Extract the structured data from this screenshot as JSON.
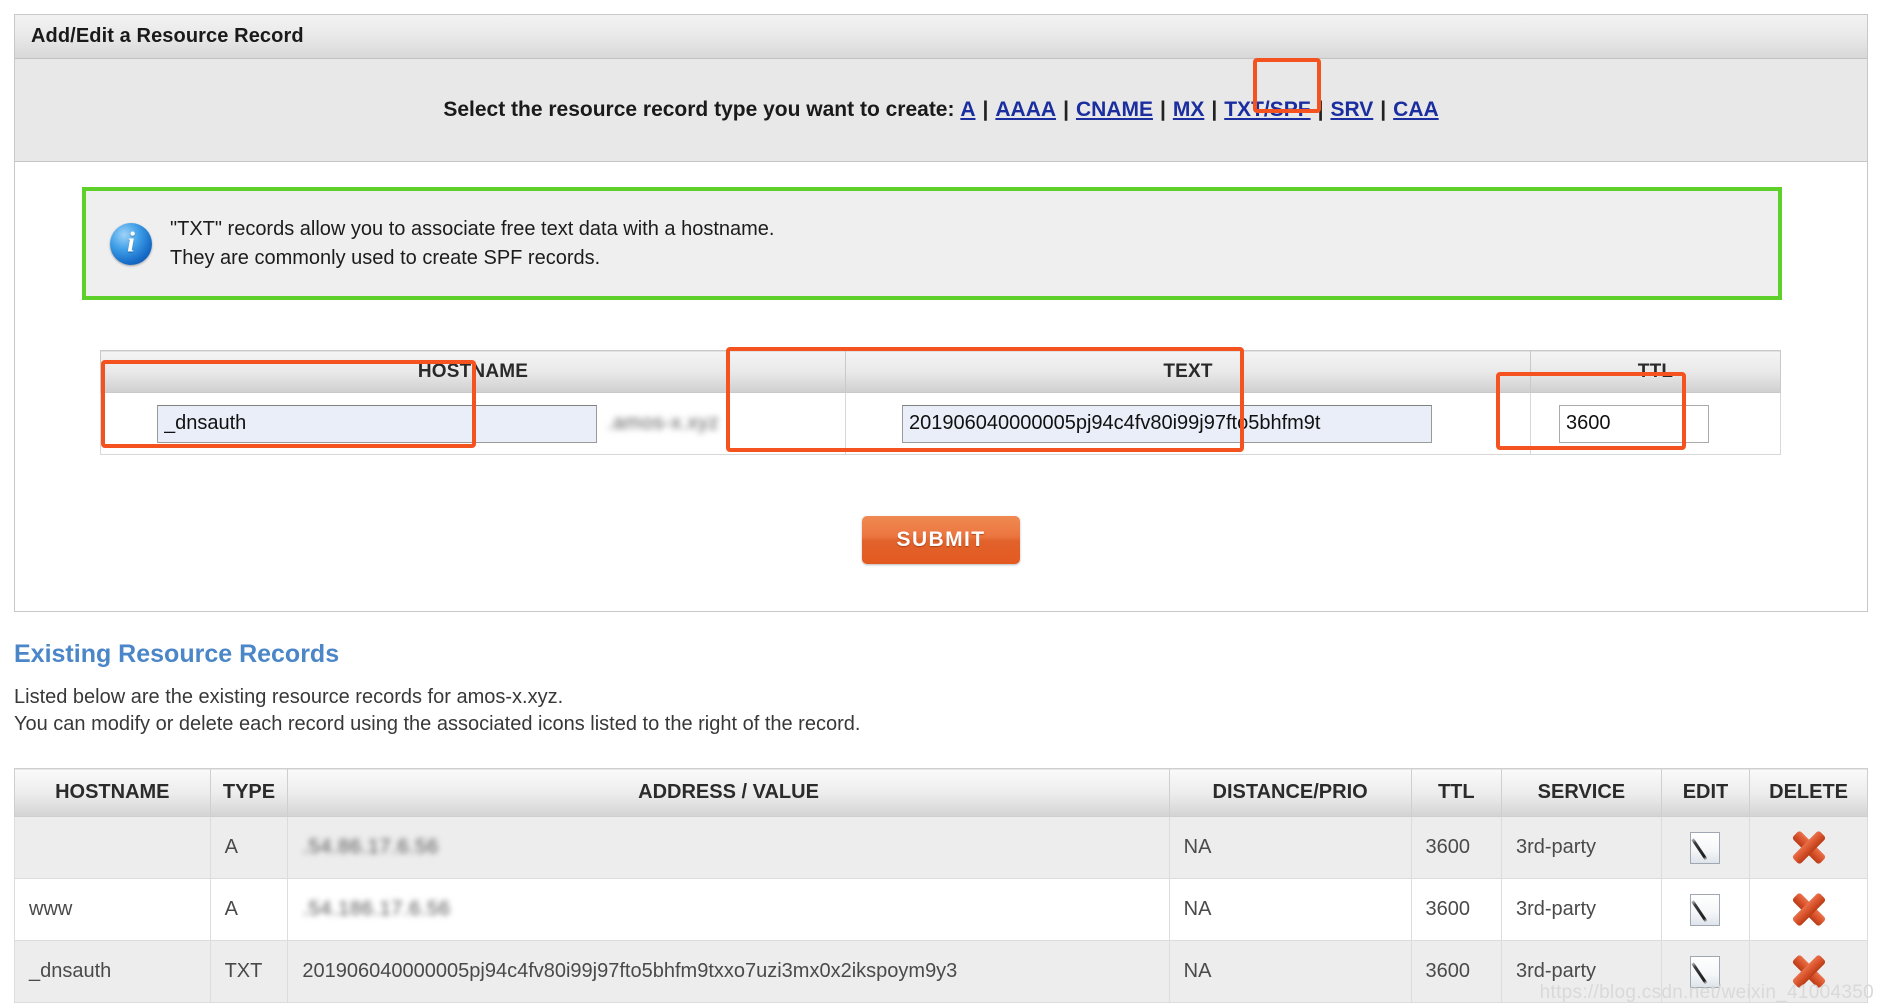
{
  "panel": {
    "title": "Add/Edit a Resource Record",
    "type_prompt": "Select the resource record type you want to create:",
    "record_types": [
      {
        "label": "A",
        "selected": false
      },
      {
        "label": "AAAA",
        "selected": false
      },
      {
        "label": "CNAME",
        "selected": false
      },
      {
        "label": "MX",
        "selected": false
      },
      {
        "label": "TXT/SPF",
        "selected": true
      },
      {
        "label": "SRV",
        "selected": false
      },
      {
        "label": "CAA",
        "selected": false
      }
    ],
    "separator": "|"
  },
  "info_box": {
    "icon": "info-icon",
    "line1": "\"TXT\" records allow you to associate free text data with a hostname.",
    "line2": "They are commonly used to create SPF records.",
    "border_color": "#5dd02a"
  },
  "form": {
    "headers": {
      "hostname": "HOSTNAME",
      "text": "TEXT",
      "ttl": "TTL"
    },
    "hostname_value": "_dnsauth",
    "hostname_suffix_blurred": ".amos-x.xyz",
    "text_value": "201906040000005pj94c4fv80i99j97fto5bhfm9t",
    "ttl_value": "3600",
    "submit_label": "SUBMIT",
    "highlight_color": "#f4521f"
  },
  "existing": {
    "title": "Existing Resource Records",
    "desc_line1": "Listed below are the existing resource records for amos-x.xyz.",
    "desc_line2": "You can modify or delete each record using the associated icons listed to the right of the record.",
    "columns": [
      "HOSTNAME",
      "TYPE",
      "ADDRESS / VALUE",
      "DISTANCE/PRIO",
      "TTL",
      "SERVICE",
      "EDIT",
      "DELETE"
    ],
    "rows": [
      {
        "hostname": "",
        "type": "A",
        "value": ".54.86.17.6.56",
        "value_blurred": true,
        "distance": "NA",
        "ttl": "3600",
        "service": "3rd-party",
        "edit_icon": "edit-pencil-icon",
        "delete_icon": "delete-x-icon"
      },
      {
        "hostname": "www",
        "type": "A",
        "value": ".54.186.17.6.56",
        "value_blurred": true,
        "distance": "NA",
        "ttl": "3600",
        "service": "3rd-party",
        "edit_icon": "edit-pencil-icon",
        "delete_icon": "delete-x-icon"
      },
      {
        "hostname": "_dnsauth",
        "type": "TXT",
        "value": "201906040000005pj94c4fv80i99j97fto5bhfm9txxo7uzi3mx0x2ikspoym9y3",
        "value_blurred": false,
        "distance": "NA",
        "ttl": "3600",
        "service": "3rd-party",
        "edit_icon": "edit-pencil-icon",
        "delete_icon": "delete-x-icon"
      }
    ]
  },
  "watermark": "https://blog.csdn.net/weixin_41004350"
}
